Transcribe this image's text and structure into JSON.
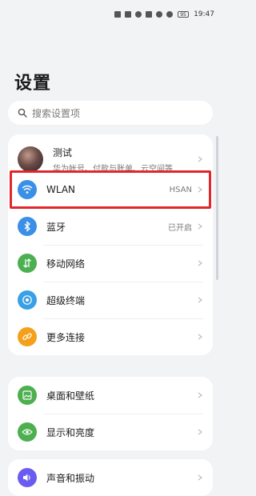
{
  "status": {
    "time": "19:47",
    "battery": "95"
  },
  "title": "设置",
  "search": {
    "placeholder": "搜索设置项"
  },
  "account": {
    "name": "测试",
    "subtitle": "华为帐号、付款与账单、云空间等"
  },
  "network": [
    {
      "label": "WLAN",
      "value": "HSAN",
      "icon": "wifi-icon",
      "color": "#3a8fe6"
    },
    {
      "label": "蓝牙",
      "value": "已开启",
      "icon": "bluetooth-icon",
      "color": "#3a8fe6"
    },
    {
      "label": "移动网络",
      "value": "",
      "icon": "mobile-network-icon",
      "color": "#4caf50"
    },
    {
      "label": "超级终端",
      "value": "",
      "icon": "super-device-icon",
      "color": "#3aa0e6"
    },
    {
      "label": "更多连接",
      "value": "",
      "icon": "link-icon",
      "color": "#f3a11c"
    }
  ],
  "display": [
    {
      "label": "桌面和壁纸",
      "icon": "wallpaper-icon",
      "color": "#4caf50"
    },
    {
      "label": "显示和亮度",
      "icon": "eye-icon",
      "color": "#4caf50"
    }
  ],
  "sound": {
    "label": "声音和振动",
    "icon": "sound-icon",
    "color": "#6a5cf0"
  }
}
